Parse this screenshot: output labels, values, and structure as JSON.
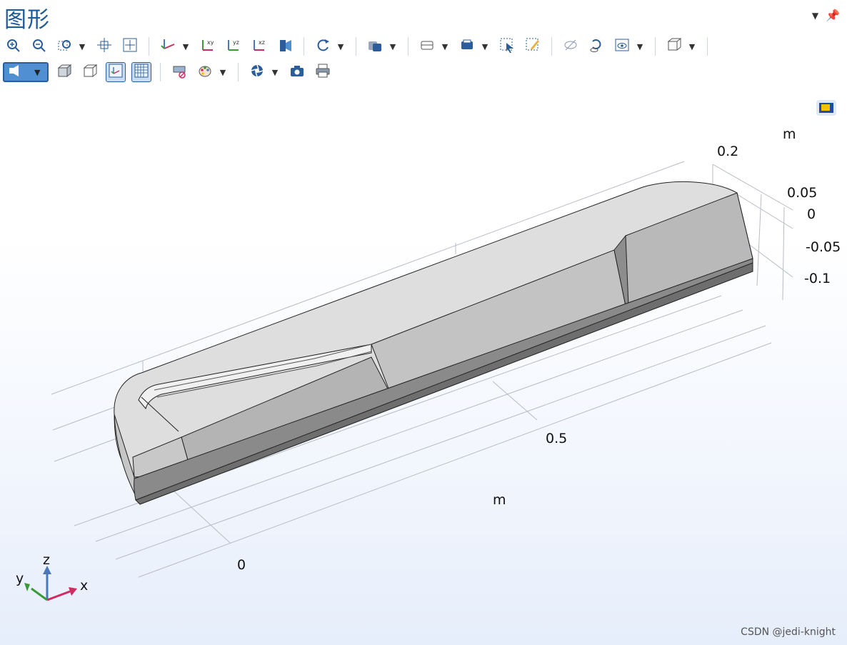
{
  "window": {
    "title": "图形"
  },
  "toolbar": {
    "row1": [
      {
        "name": "zoom-in-button",
        "icon": "zoom-in-icon"
      },
      {
        "name": "zoom-out-button",
        "icon": "zoom-out-icon"
      },
      {
        "name": "zoom-box-button",
        "icon": "zoom-box-icon",
        "dropdown": true
      },
      {
        "name": "zoom-selection-button",
        "icon": "zoom-selection-icon"
      },
      {
        "name": "zoom-extents-button",
        "icon": "zoom-extents-icon"
      },
      {
        "sep": true
      },
      {
        "name": "default-view-button",
        "icon": "axis-view-icon",
        "dropdown": true
      },
      {
        "name": "xy-view-button",
        "icon": "xy-view-icon"
      },
      {
        "name": "yz-view-button",
        "icon": "yz-view-icon"
      },
      {
        "name": "xz-view-button",
        "icon": "xz-view-icon"
      },
      {
        "name": "camera-view-button",
        "icon": "camera-view-icon"
      },
      {
        "sep": true
      },
      {
        "name": "rotate-button",
        "icon": "rotate-icon",
        "dropdown": true
      },
      {
        "sep": true
      },
      {
        "name": "transparency-button",
        "icon": "transparency-icon",
        "dropdown": true
      },
      {
        "sep": true
      },
      {
        "name": "wireframe-button",
        "icon": "wireframe-icon",
        "dropdown": true
      },
      {
        "name": "render-mode-button",
        "icon": "render-mode-icon",
        "dropdown": true
      },
      {
        "name": "select-box-button",
        "icon": "select-box-icon"
      },
      {
        "name": "clear-selection-button",
        "icon": "clear-selection-icon"
      },
      {
        "sep": true
      },
      {
        "name": "hide-button",
        "icon": "hide-icon"
      },
      {
        "name": "reset-hiding-button",
        "icon": "reset-hiding-icon"
      },
      {
        "name": "view-button",
        "icon": "eye-view-icon",
        "dropdown": true
      },
      {
        "sep": true
      },
      {
        "name": "box-view-button",
        "icon": "box-view-icon",
        "dropdown": true
      },
      {
        "sep": true
      }
    ],
    "row2": [
      {
        "name": "scene-light-button",
        "icon": "scene-light-icon",
        "wide": true,
        "selected": true
      },
      {
        "name": "box-shaded-button",
        "icon": "box-shaded-icon"
      },
      {
        "name": "box-wire-button",
        "icon": "box-wire-icon"
      },
      {
        "name": "show-axis-button",
        "icon": "show-axis-icon",
        "selected": true
      },
      {
        "name": "show-grid-button",
        "icon": "grid-icon",
        "selected": true
      },
      {
        "sep": true
      },
      {
        "name": "hide-layer-button",
        "icon": "hide-layer-icon"
      },
      {
        "name": "color-theme-button",
        "icon": "palette-icon",
        "dropdown": true
      },
      {
        "sep": true
      },
      {
        "name": "aperture-button",
        "icon": "aperture-icon",
        "dropdown": true
      },
      {
        "name": "snapshot-button",
        "icon": "camera-icon"
      },
      {
        "name": "print-button",
        "icon": "print-icon"
      }
    ]
  },
  "axes": {
    "x_unit": "m",
    "z_unit": "m",
    "x_ticks": [
      "0",
      "0.5"
    ],
    "z_ticks": [
      "0.2",
      "0.05",
      "0",
      "-0.05",
      "-0.1"
    ],
    "triad": {
      "x": "x",
      "y": "y",
      "z": "z"
    }
  },
  "watermark": "CSDN @jedi-knight",
  "colors": {
    "title": "#1e5a9c",
    "accent": "#4f8fd2",
    "triad_x": "#d12b5f",
    "triad_y": "#3a9a3a",
    "triad_z": "#4a78b8"
  }
}
